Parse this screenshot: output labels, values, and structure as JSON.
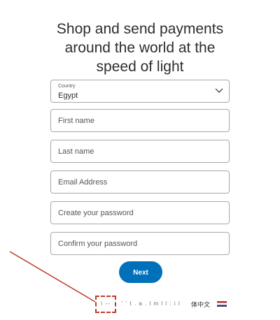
{
  "headline": {
    "line1": "Shop and send payments",
    "line2": "around the world at the",
    "line3": "speed of light"
  },
  "country": {
    "label": "Country",
    "value": "Egypt"
  },
  "form": {
    "first_name_placeholder": "First name",
    "last_name_placeholder": "Last name",
    "email_placeholder": "Email Address",
    "password_placeholder": "Create your password",
    "confirm_password_placeholder": "Confirm your password",
    "next_label": "Next"
  },
  "languages": {
    "partial_1": "\\ --",
    "partial_2": "' ' t . a . l  m l  l : i  l",
    "chinese_label": "体中文",
    "flag_icon": "flag-icon"
  },
  "colors": {
    "primary_button": "#0070ba",
    "annotation": "#c0392b",
    "border": "#a8a8a8"
  }
}
